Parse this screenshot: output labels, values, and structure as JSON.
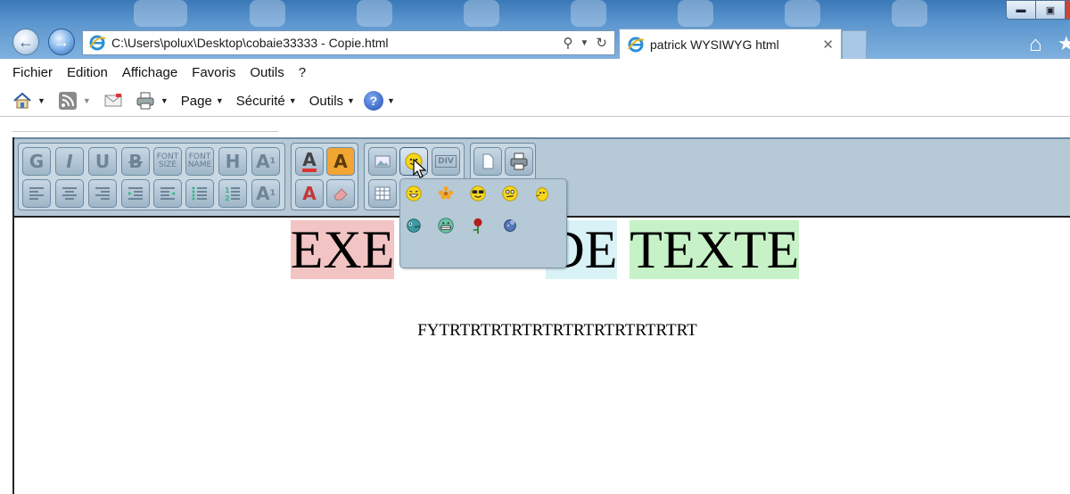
{
  "browser": {
    "address_url": "C:\\Users\\polux\\Desktop\\cobaie33333 - Copie.html",
    "tab_title": "patrick WYSIWYG html",
    "tab_close_symbol": "✕",
    "back_icon": "back-arrow-icon",
    "forward_icon": "forward-arrow-icon"
  },
  "menubar": {
    "items": [
      "Fichier",
      "Edition",
      "Affichage",
      "Favoris",
      "Outils",
      "?"
    ]
  },
  "commandbar": {
    "page_label": "Page",
    "security_label": "Sécurité",
    "tools_label": "Outils",
    "help_symbol": "?"
  },
  "editor": {
    "toolbar": {
      "bold": "G",
      "italic": "I",
      "underline": "U",
      "strike": "B",
      "font_size": "FONT SIZE",
      "font_name": "FONT NAME",
      "heading": "H",
      "superscript": "A",
      "subscript": "A",
      "forecolor": "A",
      "backcolor": "A",
      "textcolor_red": "A",
      "div_label": "DIV"
    },
    "content": {
      "heading_words": [
        "EXE",
        "",
        "DE",
        "TEXTE"
      ],
      "paragraph": "FYTRTRTRTRTRTRTRTRTRTRTRTRT"
    }
  },
  "colors": {
    "toolbar_bg": "#b6c9d6",
    "heading_pink": "#f3c4c4",
    "heading_cyan": "#d8f2f6",
    "heading_green": "#c7f2c7"
  }
}
